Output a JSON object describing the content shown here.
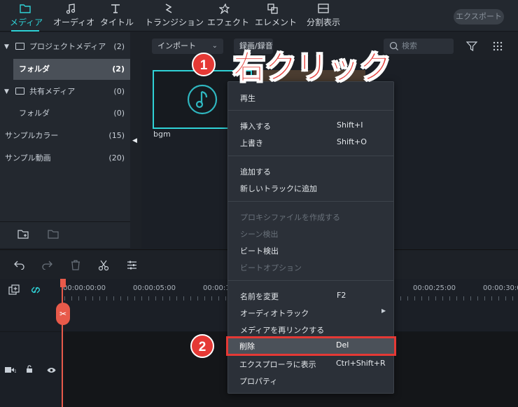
{
  "top_tabs": [
    {
      "label": "メディア",
      "icon": "folder-icon",
      "active": true
    },
    {
      "label": "オーディオ",
      "icon": "music-note-icon"
    },
    {
      "label": "タイトル",
      "icon": "title-t-icon"
    },
    {
      "label": "トランジション",
      "icon": "transition-icon"
    },
    {
      "label": "エフェクト",
      "icon": "effect-star-icon"
    },
    {
      "label": "エレメント",
      "icon": "element-icon"
    },
    {
      "label": "分割表示",
      "icon": "split-screen-icon"
    }
  ],
  "export_label": "エクスポート",
  "sidebar": {
    "items": [
      {
        "label": "プロジェクトメディア",
        "count": "(2)"
      },
      {
        "label": "フォルダ",
        "count": "(2)"
      },
      {
        "label": "共有メディア",
        "count": "(0)"
      },
      {
        "label": "フォルダ",
        "count": "(0)"
      },
      {
        "label": "サンプルカラー",
        "count": "(15)"
      },
      {
        "label": "サンプル動画",
        "count": "(20)"
      }
    ]
  },
  "media_bar": {
    "import_label": "インポート",
    "record_label": "録画/録音",
    "search_placeholder": "検索"
  },
  "media_items": [
    {
      "name": "bgm",
      "icon": "music-note-icon"
    }
  ],
  "timeline": {
    "ruler_labels": [
      "00:00:00:00",
      "00:00:05:00",
      "00:00:1",
      "00:00:25:00",
      "00:00:30:0"
    ]
  },
  "context_menu": {
    "items": [
      {
        "label": "再生",
        "shortcut": ""
      },
      {
        "label": "挿入する",
        "shortcut": "Shift+I"
      },
      {
        "label": "上書き",
        "shortcut": "Shift+O"
      },
      {
        "label": "追加する",
        "shortcut": ""
      },
      {
        "label": "新しいトラックに追加",
        "shortcut": ""
      },
      {
        "label": "プロキシファイルを作成する",
        "shortcut": "",
        "disabled": true
      },
      {
        "label": "シーン検出",
        "shortcut": "",
        "disabled": true
      },
      {
        "label": "ビート検出",
        "shortcut": ""
      },
      {
        "label": "ビートオプション",
        "shortcut": "",
        "disabled": true
      },
      {
        "label": "名前を変更",
        "shortcut": "F2"
      },
      {
        "label": "オーディオトラック",
        "shortcut": ""
      },
      {
        "label": "メディアを再リンクする",
        "shortcut": ""
      },
      {
        "label": "削除",
        "shortcut": "Del"
      },
      {
        "label": "エクスプローラに表示",
        "shortcut": "Ctrl+Shift+R"
      },
      {
        "label": "プロパティ",
        "shortcut": ""
      }
    ]
  },
  "annotations": {
    "step1_number": "1",
    "step1_text": "右クリック",
    "step2_number": "2"
  },
  "colors": {
    "accent": "#2fd2d6",
    "annotation_red": "#e53935",
    "playhead": "#e85a4a"
  }
}
